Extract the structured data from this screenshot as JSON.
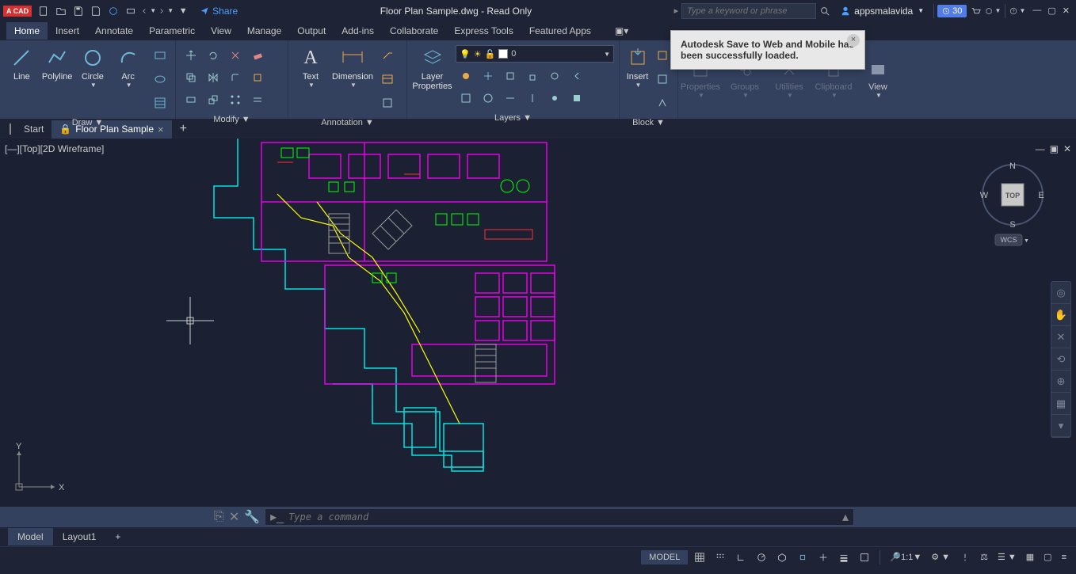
{
  "app": {
    "badge": "A CAD",
    "title": "Floor Plan Sample.dwg - Read Only"
  },
  "share_label": "Share",
  "search": {
    "placeholder": "Type a keyword or phrase"
  },
  "user": {
    "name": "appsmalavida"
  },
  "trial": {
    "days": "30"
  },
  "menu": [
    "Home",
    "Insert",
    "Annotate",
    "Parametric",
    "View",
    "Manage",
    "Output",
    "Add-ins",
    "Collaborate",
    "Express Tools",
    "Featured Apps"
  ],
  "ribbon": {
    "draw": {
      "label": "Draw",
      "tools": {
        "line": "Line",
        "polyline": "Polyline",
        "circle": "Circle",
        "arc": "Arc"
      }
    },
    "modify": {
      "label": "Modify"
    },
    "annotation": {
      "label": "Annotation",
      "tools": {
        "text": "Text",
        "dimension": "Dimension"
      }
    },
    "layers": {
      "label": "Layers",
      "tools": {
        "props": "Layer\nProperties"
      },
      "current": "0"
    },
    "block": {
      "label": "Block",
      "tools": {
        "insert": "Insert"
      }
    },
    "collapsed": {
      "properties": "Properties",
      "groups": "Groups",
      "utilities": "Utilities",
      "clipboard": "Clipboard",
      "view": "View"
    }
  },
  "file_tabs": {
    "start": "Start",
    "active": "Floor Plan Sample"
  },
  "viewport": {
    "label": "[—][Top][2D Wireframe]",
    "wcs": "WCS"
  },
  "viewcube": {
    "top": "TOP",
    "n": "N",
    "s": "S",
    "e": "E",
    "w": "W"
  },
  "ucs": {
    "x": "X",
    "y": "Y"
  },
  "command": {
    "placeholder": "Type a command"
  },
  "layout_tabs": {
    "model": "Model",
    "layout1": "Layout1"
  },
  "status": {
    "model": "MODEL",
    "scale": "1:1"
  },
  "toast": {
    "message": "Autodesk Save to Web and Mobile has been successfully loaded."
  }
}
